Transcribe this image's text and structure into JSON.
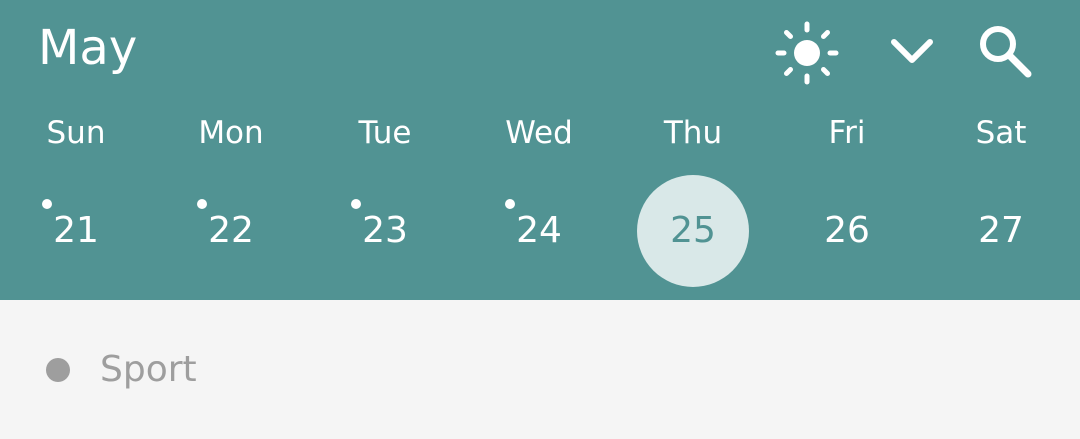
{
  "header": {
    "month": "May",
    "icons": [
      "sun-icon",
      "chevron-down-icon",
      "search-icon"
    ]
  },
  "week": {
    "days": [
      {
        "weekday": "Sun",
        "date": "21",
        "has_event": true,
        "selected": false
      },
      {
        "weekday": "Mon",
        "date": "22",
        "has_event": true,
        "selected": false
      },
      {
        "weekday": "Tue",
        "date": "23",
        "has_event": true,
        "selected": false
      },
      {
        "weekday": "Wed",
        "date": "24",
        "has_event": true,
        "selected": false
      },
      {
        "weekday": "Thu",
        "date": "25",
        "has_event": false,
        "selected": true
      },
      {
        "weekday": "Fri",
        "date": "26",
        "has_event": false,
        "selected": false
      },
      {
        "weekday": "Sat",
        "date": "27",
        "has_event": false,
        "selected": false
      }
    ]
  },
  "events": [
    {
      "label": "Sport",
      "color": "#9e9e9e"
    }
  ],
  "colors": {
    "header_bg": "#519393",
    "selected_bg": "#d9e8e8",
    "selected_text": "#519393",
    "body_bg": "#f5f5f5"
  }
}
